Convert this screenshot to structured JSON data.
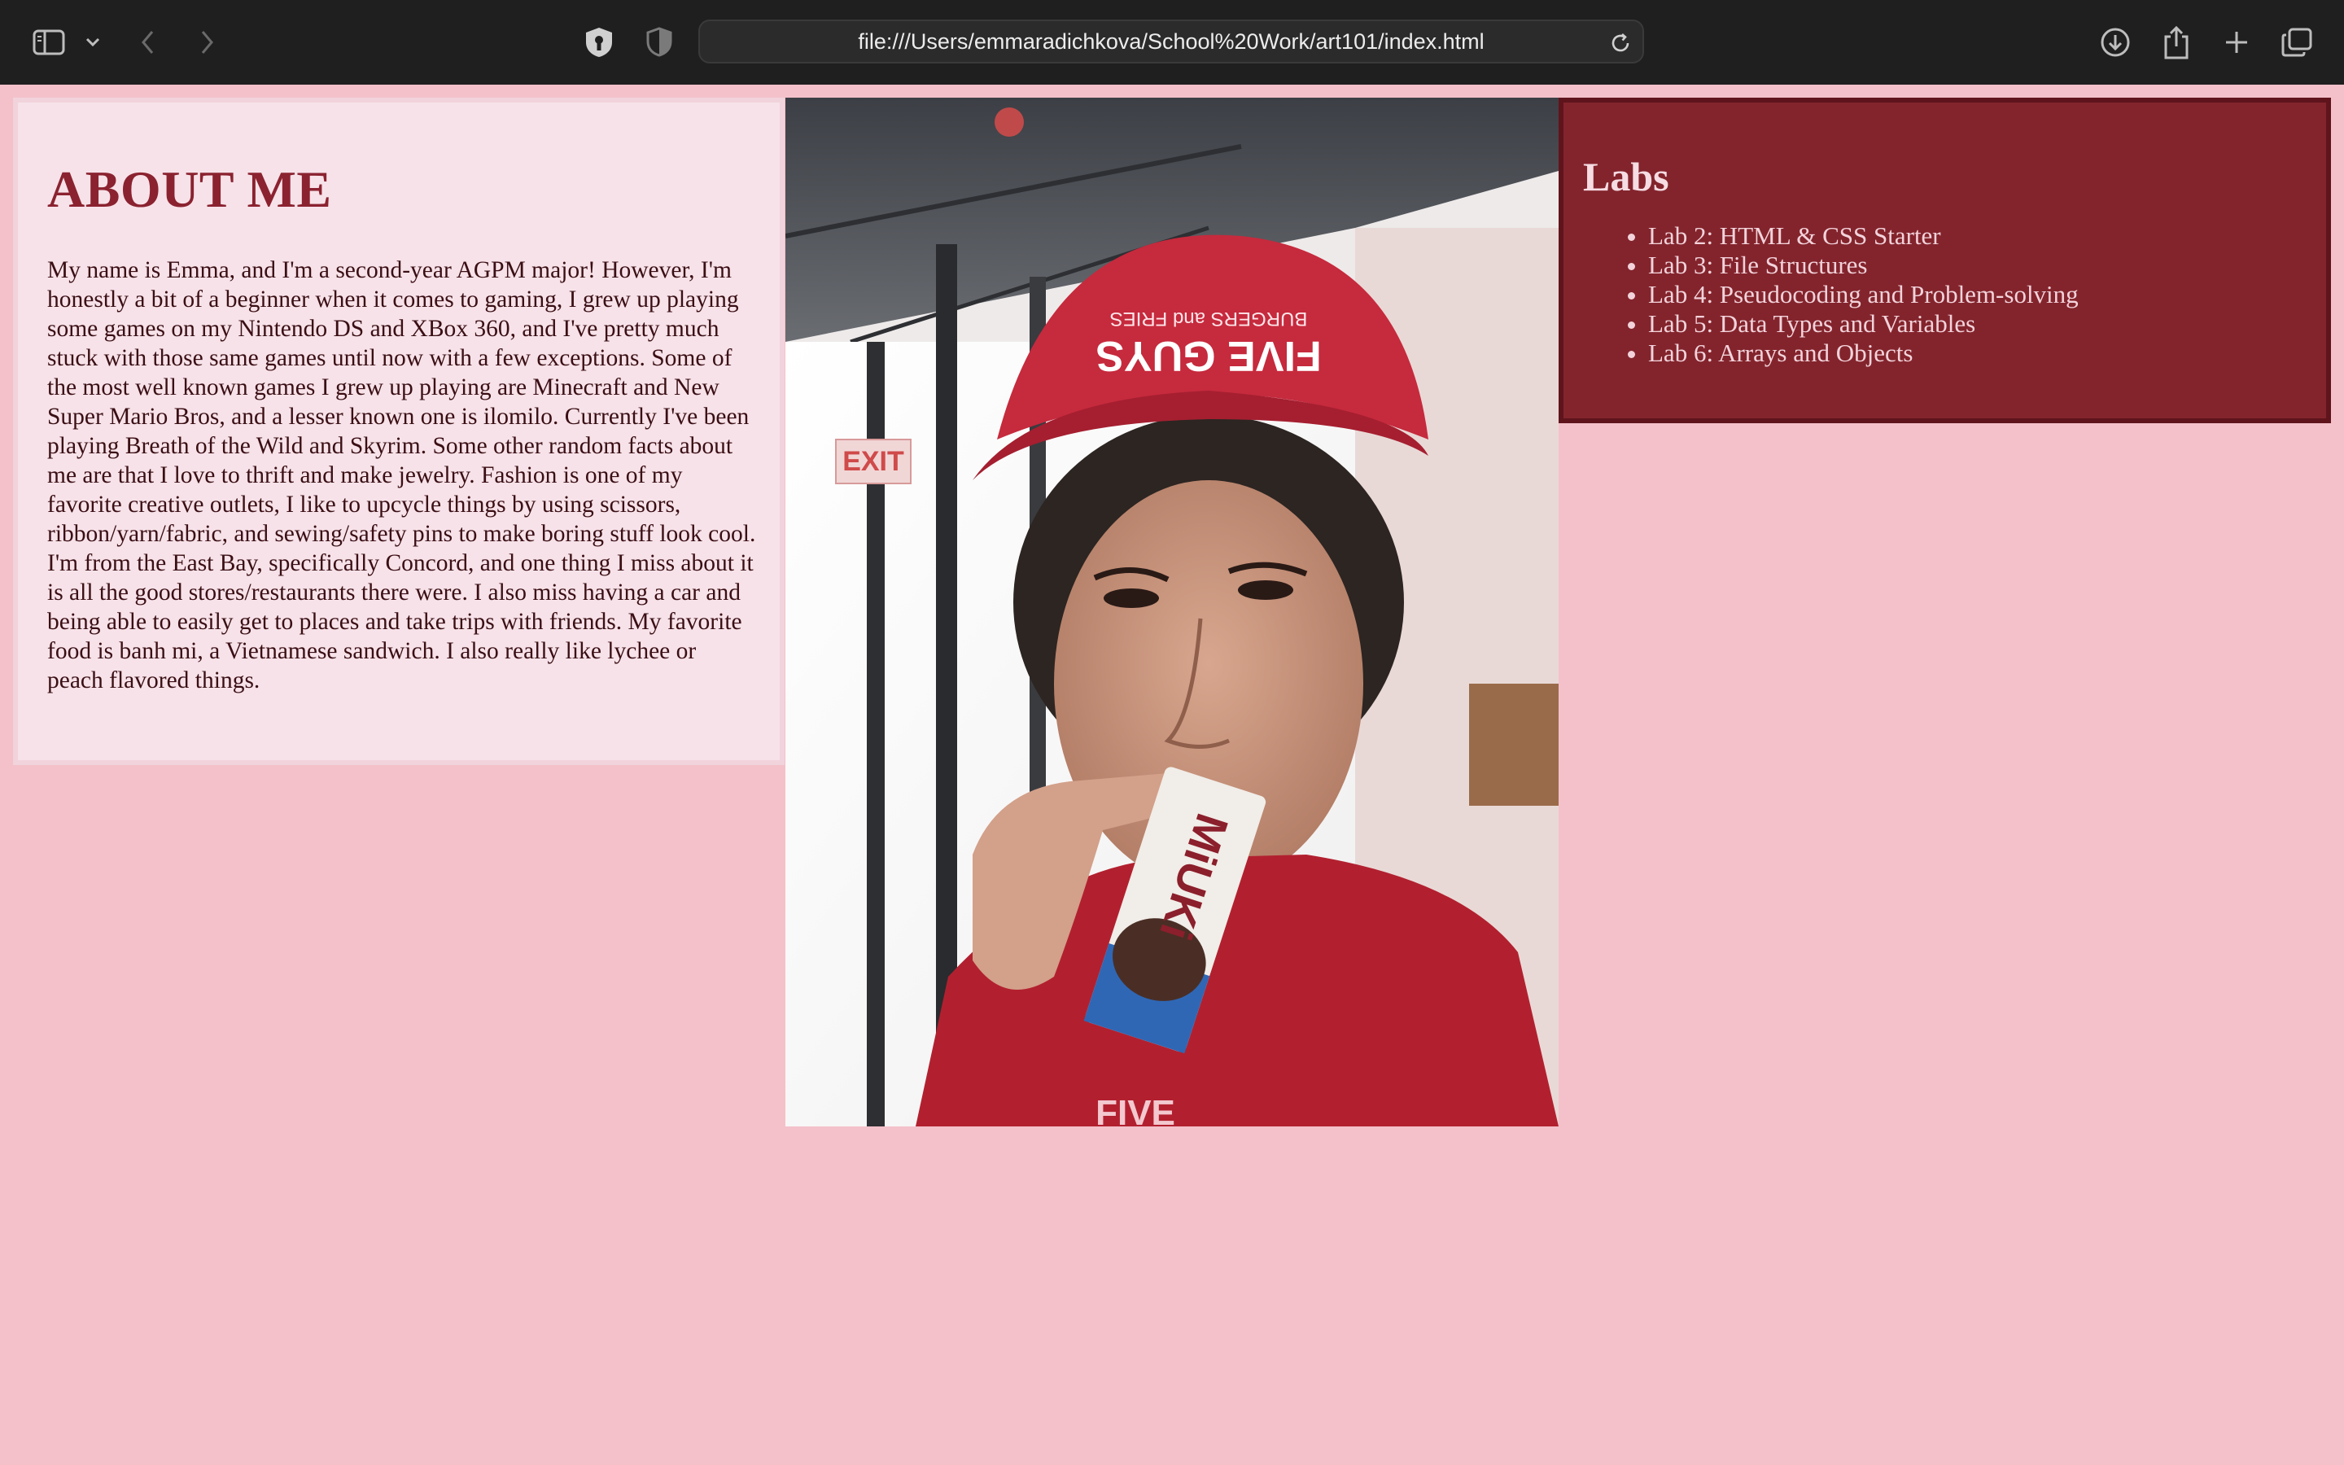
{
  "browser": {
    "url": "file:///Users/emmaradichkova/School%20Work/art101/index.html"
  },
  "about": {
    "heading": "ABOUT ME",
    "body": "My name is Emma, and I'm a second-year AGPM major! However, I'm honestly a bit of a beginner when it comes to gaming, I grew up playing some games on my Nintendo DS and XBox 360, and I've pretty much stuck with those same games until now with a few exceptions. Some of the most well known games I grew up playing are Minecraft and New Super Mario Bros, and a lesser known one is ilomilo. Currently I've been playing Breath of the Wild and Skyrim. Some other random facts about me are that I love to thrift and make jewelry. Fashion is one of my favorite creative outlets, I like to upcycle things by using scissors, ribbon/yarn/fabric, and sewing/safety pins to make boring stuff look cool. I'm from the East Bay, specifically Concord, and one thing I miss about it is all the good stores/restaurants there were. I also miss having a car and being able to easily get to places and take trips with friends. My favorite food is banh mi, a Vietnamese sandwich. I also really like lychee or peach flavored things."
  },
  "photo": {
    "cap_text": "FIVE GUYS",
    "cap_subtext": "BURGERS and FRIES",
    "exit_sign": "EXIT",
    "shirt_text": "FIVE",
    "bar_text": "MiUKi"
  },
  "labs": {
    "heading": "Labs",
    "items": [
      {
        "label": "Lab 2: HTML & CSS Starter"
      },
      {
        "label": "Lab 3: File Structures"
      },
      {
        "label": "Lab 4: Pseudocoding and Problem-solving"
      },
      {
        "label": "Lab 5: Data Types and Variables"
      },
      {
        "label": "Lab 6: Arrays and Objects"
      }
    ]
  },
  "colors": {
    "page_bg": "#f4c1ca",
    "about_bg": "#f7e2e9",
    "heading_red": "#8b2230",
    "labs_bg": "#83242c"
  }
}
